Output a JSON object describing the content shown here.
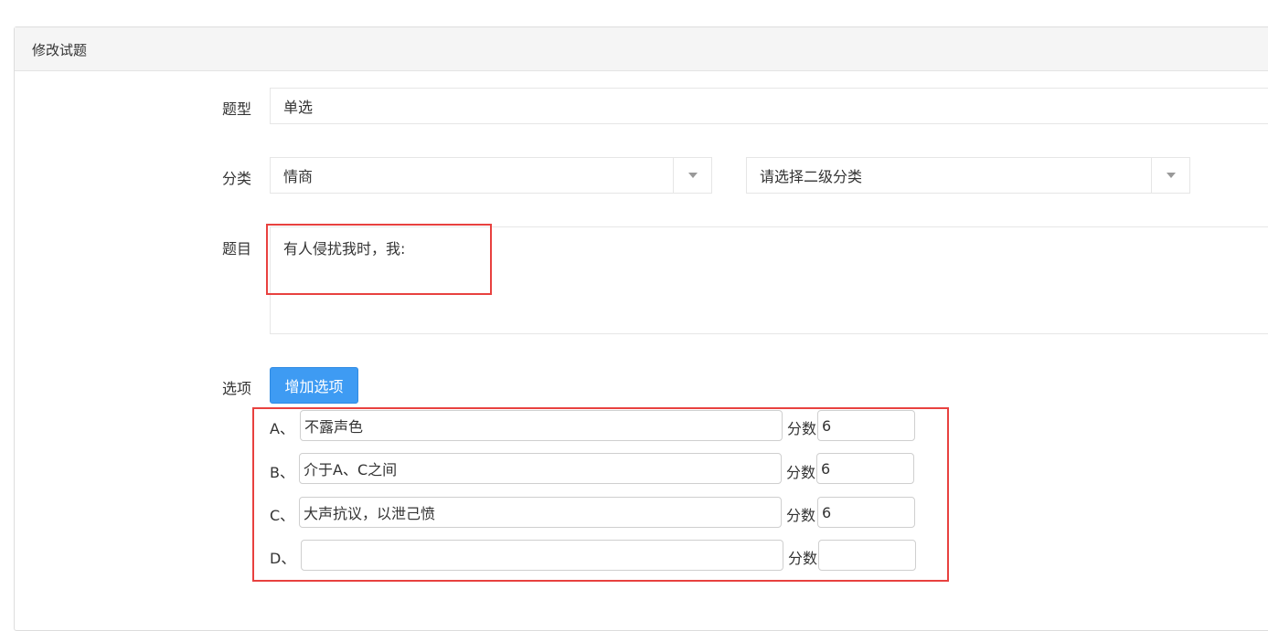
{
  "panel": {
    "title": "修改试题"
  },
  "form": {
    "type_label": "题型",
    "type_value": "单选",
    "category_label": "分类",
    "category_value": "情商",
    "subcategory_placeholder": "请选择二级分类",
    "question_label": "题目",
    "question_value": "有人侵扰我时，我:",
    "options_label": "选项",
    "add_option_button": "增加选项",
    "score_label": "分数",
    "options": [
      {
        "letter": "A、",
        "text": "不露声色",
        "score": "6"
      },
      {
        "letter": "B、",
        "text": "介于A、C之间",
        "score": "6"
      },
      {
        "letter": "C、",
        "text": "大声抗议，以泄己愤",
        "score": "6"
      },
      {
        "letter": "D、",
        "text": "",
        "score": ""
      }
    ]
  },
  "icons": {
    "select_arrow": "caret-down-icon"
  },
  "colors": {
    "accent": "#3e9bf3",
    "highlight": "#e8413f"
  }
}
